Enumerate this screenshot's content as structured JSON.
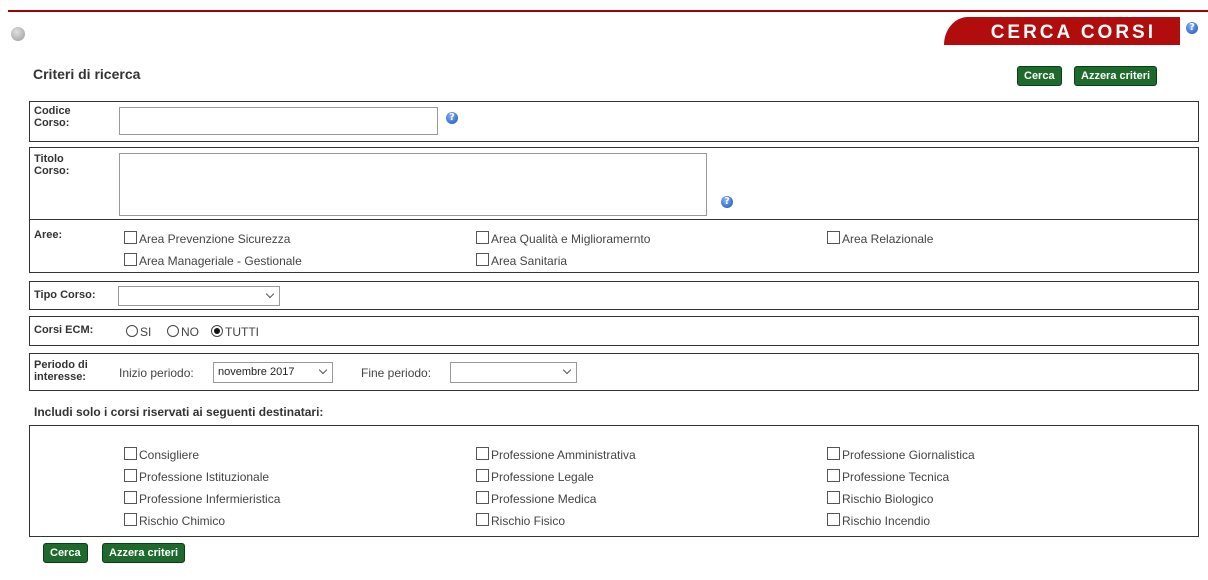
{
  "header": {
    "title": "CERCA CORSI",
    "help_glyph": "?"
  },
  "heading": "Criteri di ricerca",
  "buttons": {
    "cerca": "Cerca",
    "azzera": "Azzera criteri"
  },
  "codice": {
    "label_1": "Codice",
    "label_2": "Corso:",
    "value": ""
  },
  "titolo": {
    "label_1": "Titolo",
    "label_2": "Corso:",
    "value": ""
  },
  "aree": {
    "label": "Aree:",
    "items": [
      "Area Prevenzione Sicurezza",
      "Area Qualità e Miglioramernto",
      "Area Relazionale",
      "Area Manageriale - Gestionale",
      "Area Sanitaria"
    ]
  },
  "tipo_corso": {
    "label": "Tipo Corso:",
    "value": ""
  },
  "corsi_ecm": {
    "label": "Corsi ECM:",
    "options": [
      "SI",
      "NO",
      "TUTTI"
    ],
    "selected": "TUTTI"
  },
  "periodo": {
    "label_1": "Periodo di",
    "label_2": "interesse:",
    "inizio_label": "Inizio periodo:",
    "inizio_value": "novembre 2017",
    "fine_label": "Fine periodo:",
    "fine_value": ""
  },
  "destinatari": {
    "label": "Includi solo i corsi riservati ai seguenti destinatari:",
    "items": [
      "Consigliere",
      "Professione Amministrativa",
      "Professione Giornalistica",
      "Professione Istituzionale",
      "Professione Legale",
      "Professione Tecnica",
      "Professione Infermieristica",
      "Professione Medica",
      "Rischio Biologico",
      "Rischio Chimico",
      "Rischio Fisico",
      "Rischio Incendio"
    ]
  },
  "colors": {
    "brand_red": "#b20d0d",
    "button_green": "#1d6a2c",
    "help_blue": "#1a4fb0"
  }
}
